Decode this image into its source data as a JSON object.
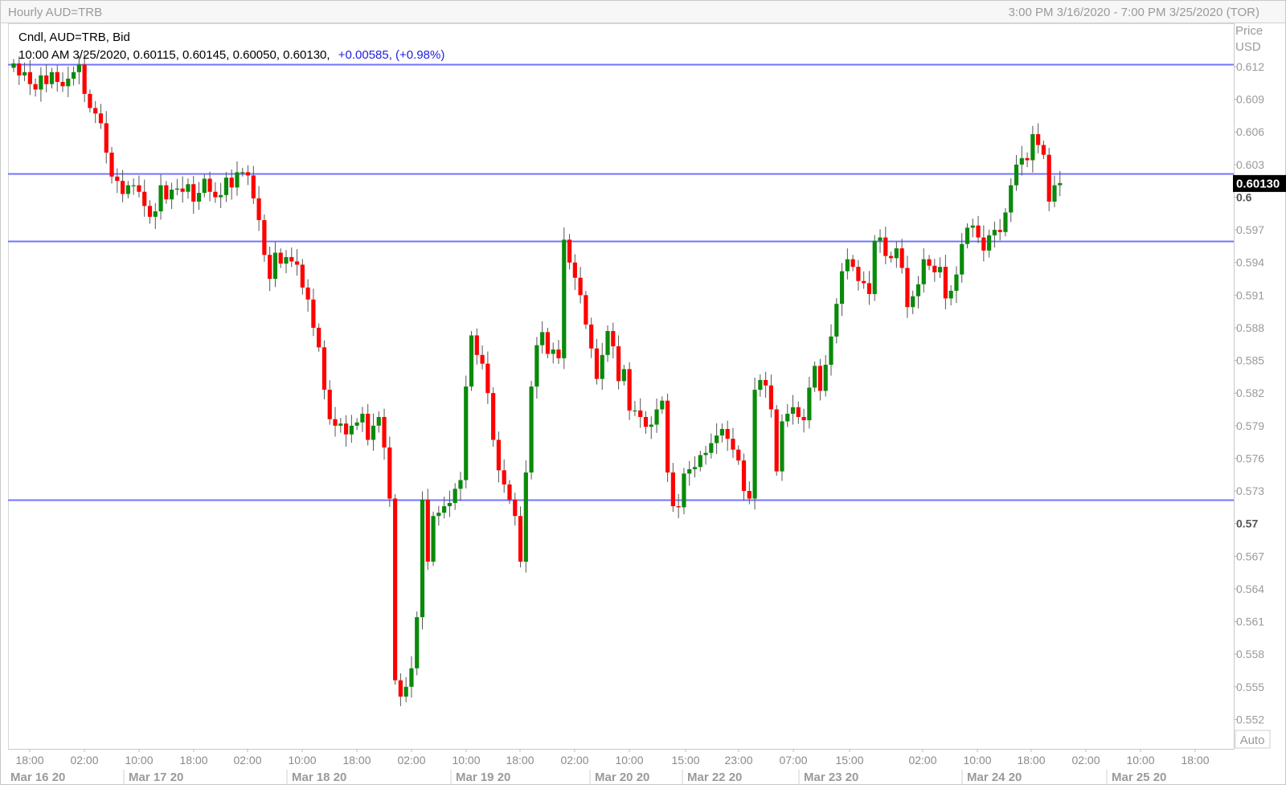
{
  "header": {
    "left_title": "Hourly AUD=TRB",
    "right_range": "3:00 PM 3/16/2020 - 7:00 PM 3/25/2020 (TOR)"
  },
  "legend": {
    "series_label": "Cndl, AUD=TRB, Bid",
    "ohlc_line": "10:00 AM 3/25/2020, 0.60115, 0.60145, 0.60050, 0.60130,",
    "change": "+0.00585, (+0.98%)"
  },
  "axis": {
    "price_label": "Price",
    "currency_label": "USD",
    "auto_label": "Auto",
    "current_price_label": "0.60130"
  },
  "colors": {
    "up": "#0a8a0a",
    "down": "#ff0000",
    "hline": "#7373ff",
    "current_bg": "#000000"
  },
  "chart_data": {
    "type": "candlestick",
    "symbol": "AUD=TRB",
    "interval": "Hourly",
    "price_unit": "USD",
    "ylim": [
      0.5505,
      0.6145
    ],
    "yticks": [
      "0.612",
      "0.609",
      "0.606",
      "0.603",
      "0.6",
      "0.597",
      "0.594",
      "0.591",
      "0.588",
      "0.585",
      "0.582",
      "0.579",
      "0.576",
      "0.573",
      "0.57",
      "0.567",
      "0.564",
      "0.561",
      "0.558",
      "0.555",
      "0.552"
    ],
    "bold_yticks": [
      "0.6",
      "0.57"
    ],
    "current_price": 0.6013,
    "horizontal_lines": [
      0.6122,
      0.6022,
      0.596,
      0.5722
    ],
    "xticks": [
      "18:00",
      "02:00",
      "10:00",
      "18:00",
      "02:00",
      "10:00",
      "18:00",
      "02:00",
      "10:00",
      "18:00",
      "02:00",
      "10:00",
      "15:00",
      "23:00",
      "07:00",
      "15:00",
      "02:00",
      "10:00",
      "18:00",
      "02:00",
      "10:00",
      "18:00"
    ],
    "date_labels": [
      "Mar 16 20",
      "Mar 17 20",
      "Mar 18 20",
      "Mar 19 20",
      "Mar 20 20",
      "Mar 22 20",
      "Mar 23 20",
      "Mar 24 20",
      "Mar 25 20"
    ],
    "closes": [
      0.6123,
      0.6112,
      0.6115,
      0.6104,
      0.6099,
      0.6112,
      0.6104,
      0.6115,
      0.6106,
      0.6102,
      0.6109,
      0.6115,
      0.6122,
      0.6095,
      0.6082,
      0.6077,
      0.6068,
      0.6041,
      0.6019,
      0.6015,
      0.6003,
      0.6011,
      0.6011,
      0.6005,
      0.5992,
      0.5982,
      0.5987,
      0.6011,
      0.5998,
      0.6007,
      0.6008,
      0.6005,
      0.6012,
      0.5996,
      0.6004,
      0.6017,
      0.6005,
      0.6,
      0.6002,
      0.6018,
      0.6009,
      0.6023,
      0.6023,
      0.602,
      0.5999,
      0.5979,
      0.5947,
      0.5925,
      0.5949,
      0.5939,
      0.5945,
      0.5941,
      0.5938,
      0.5917,
      0.5906,
      0.588,
      0.5862,
      0.5823,
      0.5796,
      0.579,
      0.5792,
      0.5782,
      0.579,
      0.5793,
      0.5801,
      0.5777,
      0.579,
      0.5798,
      0.577,
      0.5723,
      0.5556,
      0.5541,
      0.555,
      0.5567,
      0.5614,
      0.5722,
      0.5665,
      0.5707,
      0.571,
      0.5716,
      0.5719,
      0.5732,
      0.574,
      0.5826,
      0.5873,
      0.5855,
      0.5847,
      0.582,
      0.5777,
      0.5749,
      0.5736,
      0.5722,
      0.5707,
      0.5665,
      0.5747,
      0.5826,
      0.5864,
      0.5876,
      0.5856,
      0.586,
      0.5852,
      0.5961,
      0.594,
      0.5926,
      0.591,
      0.5883,
      0.5861,
      0.5833,
      0.5855,
      0.5877,
      0.5863,
      0.5831,
      0.5842,
      0.5804,
      0.5804,
      0.5798,
      0.5789,
      0.5791,
      0.5805,
      0.5813,
      0.5747,
      0.5716,
      0.5715,
      0.5746,
      0.575,
      0.5752,
      0.5763,
      0.5765,
      0.5774,
      0.5781,
      0.5787,
      0.5778,
      0.5768,
      0.5758,
      0.573,
      0.5723,
      0.5823,
      0.5832,
      0.5827,
      0.5805,
      0.5748,
      0.5794,
      0.5801,
      0.5807,
      0.5798,
      0.5795,
      0.5825,
      0.5845,
      0.5822,
      0.5846,
      0.5872,
      0.5902,
      0.5932,
      0.5943,
      0.5936,
      0.5923,
      0.5921,
      0.5911,
      0.596,
      0.5963,
      0.5946,
      0.5944,
      0.5953,
      0.5935,
      0.5899,
      0.5909,
      0.592,
      0.5943,
      0.5937,
      0.5931,
      0.5936,
      0.5907,
      0.5914,
      0.5929,
      0.5957,
      0.5972,
      0.5974,
      0.5963,
      0.5951,
      0.5965,
      0.597,
      0.5968,
      0.5986,
      0.6011,
      0.603,
      0.6036,
      0.6034,
      0.6058,
      0.6048,
      0.6039,
      0.5996,
      0.6011,
      0.6013
    ]
  }
}
